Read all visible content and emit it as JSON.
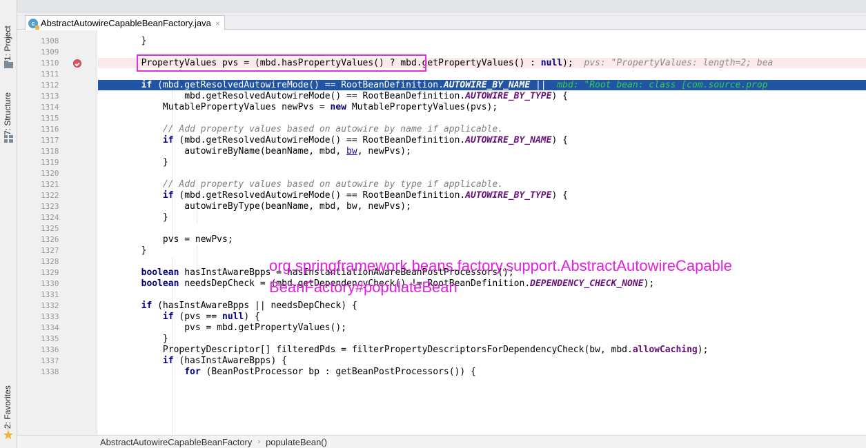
{
  "editor": {
    "tab": {
      "label": "AbstractAutowireCapableBeanFactory.java",
      "icon": "class-icon",
      "close": "×"
    }
  },
  "sidebar": {
    "project": "1: Project",
    "structure": "7: Structure",
    "favorites": "2: Favorites"
  },
  "code": {
    "lines": [
      {
        "n": "1308",
        "html": "        }"
      },
      {
        "n": "1309",
        "html": ""
      },
      {
        "n": "1310",
        "html": "        PropertyValues pvs = (mbd.hasPropertyValues() ? mbd.getPropertyValues() : <span class=\"kw\">null</span>);  <span class=\"inl\">pvs: \"PropertyValues: length=2; bea</span>",
        "breakpoint": true
      },
      {
        "n": "1311",
        "html": ""
      },
      {
        "n": "1312",
        "html": "        <span class=\"kw\">if</span> (mbd.getResolvedAutowireMode() == RootBeanDefinition.<span class=\"const\">AUTOWIRE_BY_NAME</span> ||  <span class=\"inl\">mbd: \"Root bean: class [com.source.prop</span>",
        "exec": true
      },
      {
        "n": "1313",
        "html": "                mbd.getResolvedAutowireMode() == RootBeanDefinition.<span class=\"const\">AUTOWIRE_BY_TYPE</span>) {"
      },
      {
        "n": "1314",
        "html": "            MutablePropertyValues newPvs = <span class=\"kw\">new</span> MutablePropertyValues(pvs);"
      },
      {
        "n": "1315",
        "html": ""
      },
      {
        "n": "1316",
        "html": "            <span class=\"cmt\">// Add property values based on autowire by name if applicable.</span>"
      },
      {
        "n": "1317",
        "html": "            <span class=\"kw\">if</span> (mbd.getResolvedAutowireMode() == RootBeanDefinition.<span class=\"const\">AUTOWIRE_BY_NAME</span>) {"
      },
      {
        "n": "1318",
        "html": "                autowireByName(beanName, mbd, <span class=\"ulink\">bw</span>, newPvs);"
      },
      {
        "n": "1319",
        "html": "            }"
      },
      {
        "n": "1320",
        "html": ""
      },
      {
        "n": "1321",
        "html": "            <span class=\"cmt\">// Add property values based on autowire by type if applicable.</span>"
      },
      {
        "n": "1322",
        "html": "            <span class=\"kw\">if</span> (mbd.getResolvedAutowireMode() == RootBeanDefinition.<span class=\"const\">AUTOWIRE_BY_TYPE</span>) {"
      },
      {
        "n": "1323",
        "html": "                autowireByType(beanName, mbd, bw, newPvs);"
      },
      {
        "n": "1324",
        "html": "            }"
      },
      {
        "n": "1325",
        "html": ""
      },
      {
        "n": "1326",
        "html": "            pvs = newPvs;"
      },
      {
        "n": "1327",
        "html": "        }"
      },
      {
        "n": "1328",
        "html": ""
      },
      {
        "n": "1329",
        "html": "        <span class=\"kw\">boolean</span> hasInstAwareBpps = hasInstantiationAwareBeanPostProcessors();"
      },
      {
        "n": "1330",
        "html": "        <span class=\"kw\">boolean</span> needsDepCheck = (mbd.getDependencyCheck() != RootBeanDefinition.<span class=\"const\">DEPENDENCY_CHECK_NONE</span>);"
      },
      {
        "n": "1331",
        "html": ""
      },
      {
        "n": "1332",
        "html": "        <span class=\"kw\">if</span> (hasInstAwareBpps || needsDepCheck) {"
      },
      {
        "n": "1333",
        "html": "            <span class=\"kw\">if</span> (pvs == <span class=\"kw\">null</span>) {"
      },
      {
        "n": "1334",
        "html": "                pvs = mbd.getPropertyValues();"
      },
      {
        "n": "1335",
        "html": "            }"
      },
      {
        "n": "1336",
        "html": "            PropertyDescriptor[] filteredPds = filterPropertyDescriptorsForDependencyCheck(bw, mbd.<span class=\"fld\">allowCaching</span>);"
      },
      {
        "n": "1337",
        "html": "            <span class=\"kw\">if</span> (hasInstAwareBpps) {"
      },
      {
        "n": "1338",
        "html": "                <span class=\"kw\">for</span> (BeanPostProcessor bp : getBeanPostProcessors()) {"
      }
    ]
  },
  "annotation": {
    "line1": "org.springframework.beans.factory.support.AbstractAutowireCapable",
    "line2": "BeanFactory#populateBean"
  },
  "breadcrumb": {
    "items": [
      "AbstractAutowireCapableBeanFactory",
      "populateBean()"
    ],
    "separator": "›"
  },
  "colors": {
    "highlight_box": "#ea2ae0",
    "execution_line": "#2154a4",
    "breakpoint_line": "#faeaea",
    "keyword": "#000080",
    "constant": "#660e7a"
  }
}
